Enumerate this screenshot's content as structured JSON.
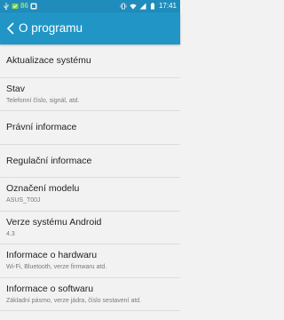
{
  "status_bar": {
    "left_number": "86",
    "time": "17:41"
  },
  "app_bar": {
    "title": "O programu"
  },
  "items": [
    {
      "label": "Aktualizace systému",
      "sub": ""
    },
    {
      "label": "Stav",
      "sub": "Telefonní číslo, signál, atd."
    },
    {
      "label": "Právní informace",
      "sub": ""
    },
    {
      "label": "Regulační informace",
      "sub": ""
    },
    {
      "label": "Označení modelu",
      "sub": "ASUS_T00J"
    },
    {
      "label": "Verze systému Android",
      "sub": "4.3"
    },
    {
      "label": "Informace o hardwaru",
      "sub": "Wi-Fi, Bluetooth, verze firmwaru atd."
    },
    {
      "label": "Informace o softwaru",
      "sub": "Základní pásmo, verze jádra, číslo sestavení atd."
    }
  ]
}
